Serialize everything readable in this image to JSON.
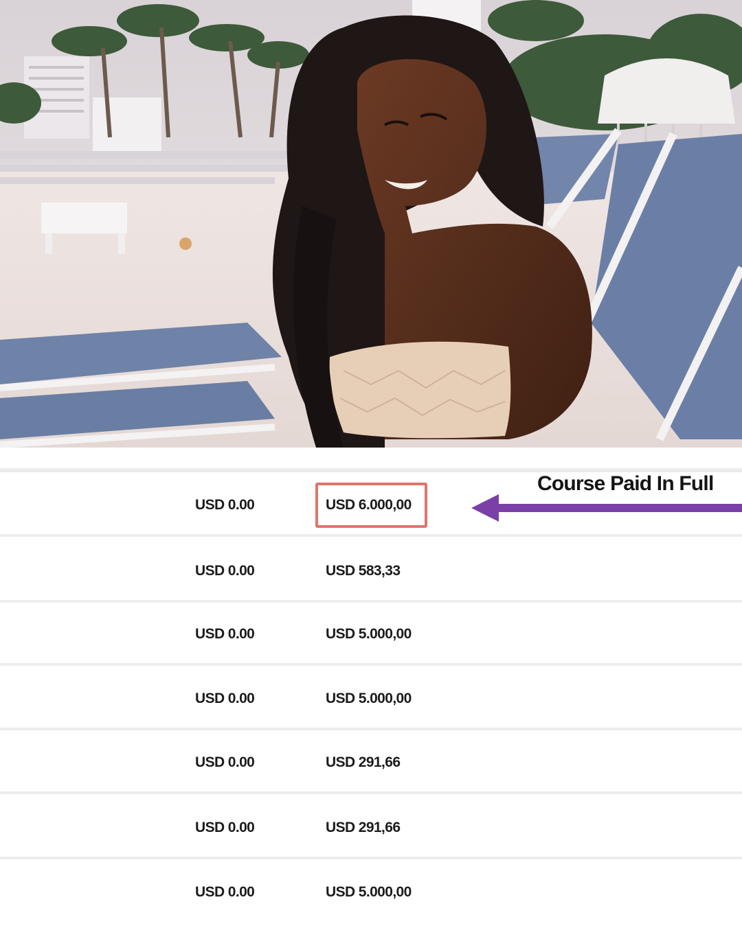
{
  "annotation": {
    "callout_text": "Course Paid In Full",
    "arrow_color": "#7b3fa8",
    "highlight_color": "#e0756c"
  },
  "rows": [
    {
      "col_a": "USD 0.00",
      "col_b": "USD 6.000,00",
      "highlighted": true
    },
    {
      "col_a": "USD 0.00",
      "col_b": "USD 583,33"
    },
    {
      "col_a": "USD 0.00",
      "col_b": "USD 5.000,00"
    },
    {
      "col_a": "USD 0.00",
      "col_b": "USD 5.000,00"
    },
    {
      "col_a": "USD 0.00",
      "col_b": "USD 291,66"
    },
    {
      "col_a": "USD 0.00",
      "col_b": "USD 291,66"
    },
    {
      "col_a": "USD 0.00",
      "col_b": "USD 5.000,00"
    }
  ]
}
